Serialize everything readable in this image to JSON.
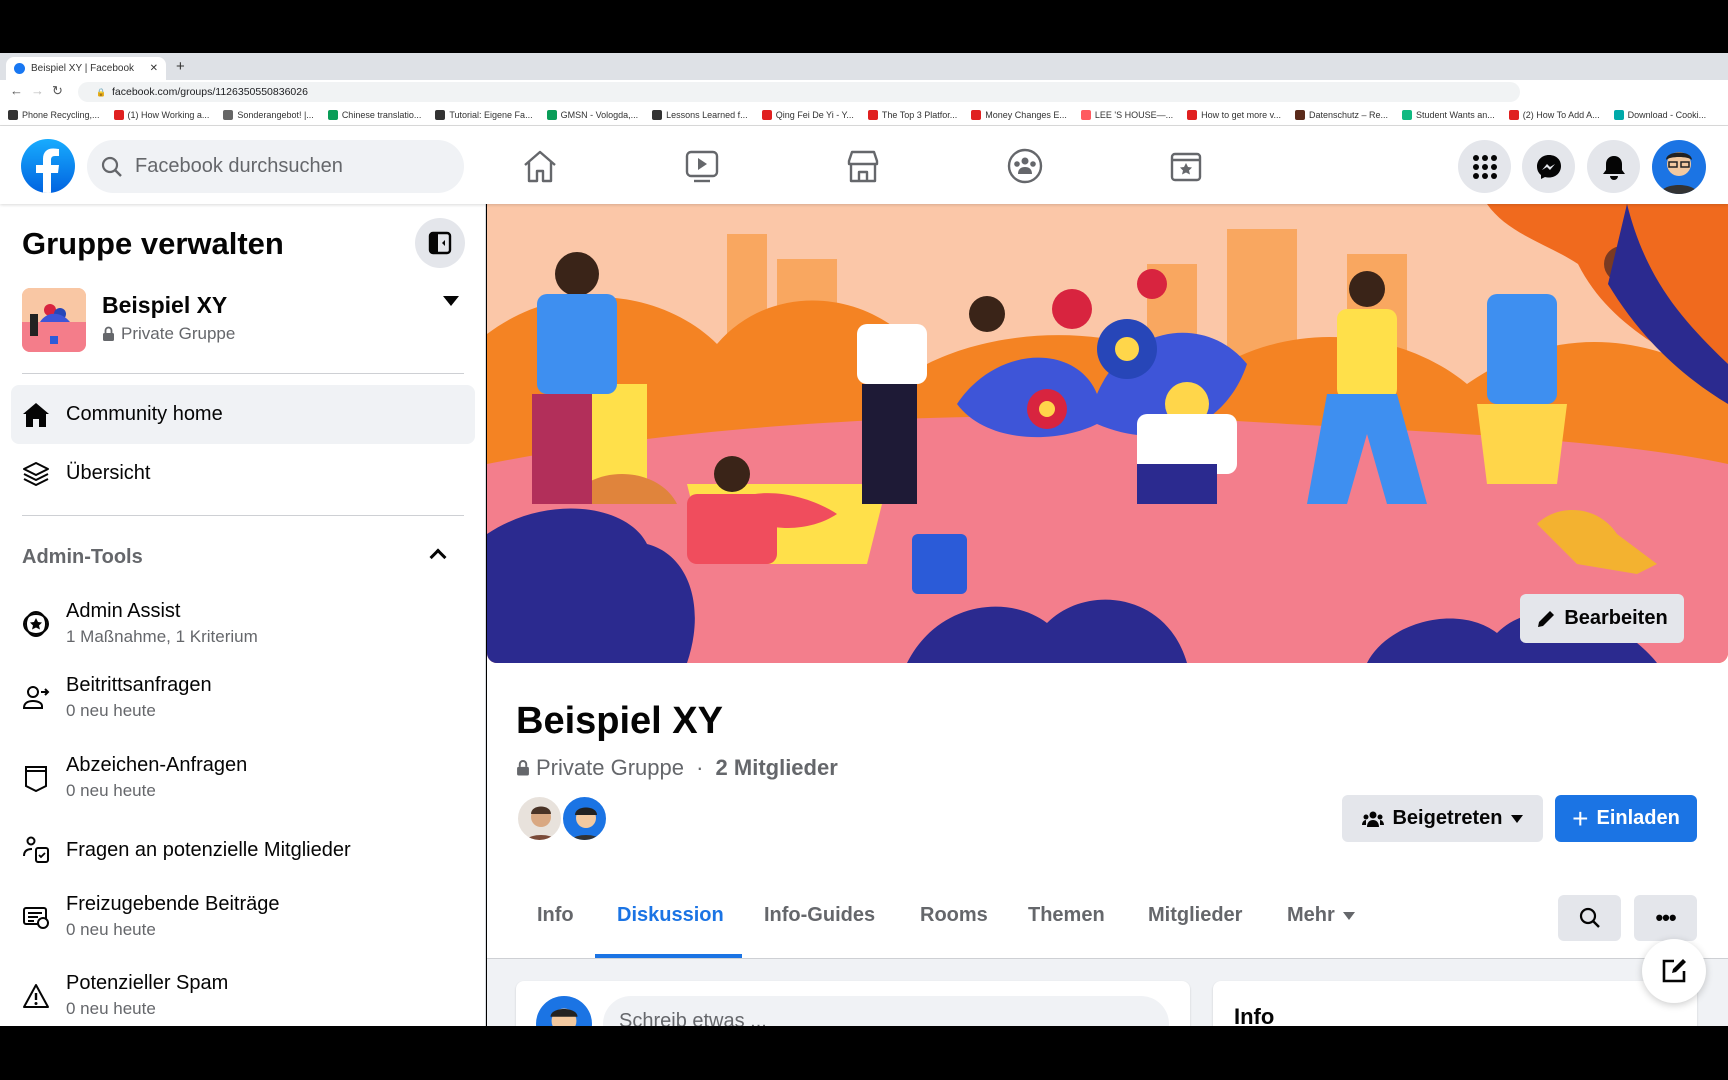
{
  "browser": {
    "tab_title": "Beispiel XY | Facebook",
    "url": "facebook.com/groups/1126350550836026",
    "bookmarks": [
      "Phone Recycling,...",
      "(1) How Working a...",
      "Sonderangebot! |...",
      "Chinese translatio...",
      "Tutorial: Eigene Fa...",
      "GMSN - Vologda,...",
      "Lessons Learned f...",
      "Qing Fei De Yi - Y...",
      "The Top 3 Platfor...",
      "Money Changes E...",
      "LEE 'S HOUSE—...",
      "How to get more v...",
      "Datenschutz – Re...",
      "Student Wants an...",
      "(2) How To Add A...",
      "Download - Cooki..."
    ]
  },
  "header": {
    "search_placeholder": "Facebook durchsuchen",
    "nav": [
      "home-icon",
      "video-icon",
      "marketplace-icon",
      "groups-icon",
      "gaming-icon"
    ]
  },
  "sidebar": {
    "title": "Gruppe verwalten",
    "group_name": "Beispiel XY",
    "group_privacy": "Private Gruppe",
    "nav": [
      {
        "label": "Community home",
        "active": true
      },
      {
        "label": "Übersicht"
      }
    ],
    "admin_tools_label": "Admin-Tools",
    "admin_items": [
      {
        "label": "Admin Assist",
        "sub": "1 Maßnahme, 1 Kriterium"
      },
      {
        "label": "Beitrittsanfragen",
        "sub": "0 neu heute"
      },
      {
        "label": "Abzeichen-Anfragen",
        "sub": "0 neu heute"
      },
      {
        "label": "Fragen an potenzielle Mitglieder"
      },
      {
        "label": "Freizugebende Beiträge",
        "sub": "0 neu heute"
      },
      {
        "label": "Potenzieller Spam",
        "sub": "0 neu heute"
      }
    ]
  },
  "group": {
    "edit_cover": "Bearbeiten",
    "name": "Beispiel XY",
    "privacy": "Private Gruppe",
    "separator": " · ",
    "members": "2 Mitglieder",
    "joined_button": "Beigetreten",
    "invite_button": "Einladen",
    "tabs": [
      "Info",
      "Diskussion",
      "Info-Guides",
      "Rooms",
      "Themen",
      "Mitglieder",
      "Mehr"
    ],
    "active_tab": "Diskussion"
  },
  "feed": {
    "composer_placeholder": "Schreib etwas ...",
    "info_title": "Info"
  },
  "colors": {
    "accent": "#1b74e4",
    "active_tab": "#1b74e4",
    "bg": "#f0f2f5"
  }
}
